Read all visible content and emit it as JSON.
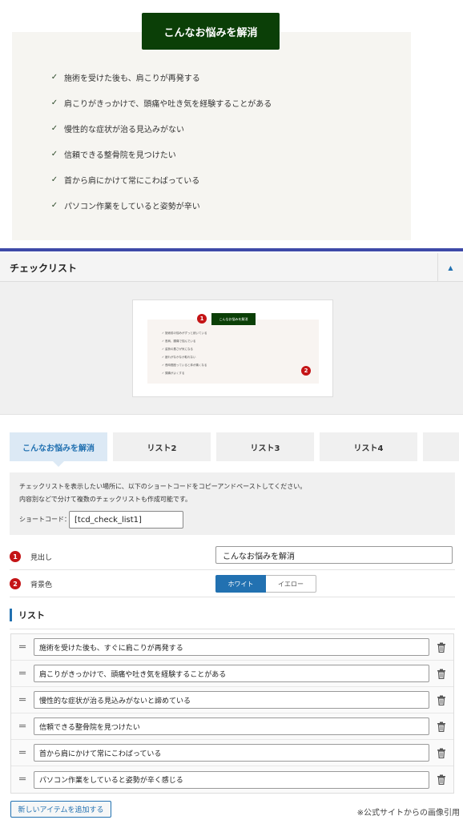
{
  "preview": {
    "title": "こんなお悩みを解消",
    "items": [
      "施術を受けた後も、肩こりが再発する",
      "肩こりがきっかけで、頭痛や吐き気を経験することがある",
      "慢性的な症状が治る見込みがない",
      "信頼できる整骨院を見つけたい",
      "首から肩にかけて常にこわばっている",
      "パソコン作業をしていると姿勢が辛い"
    ]
  },
  "panel": {
    "title": "チェックリスト",
    "toggle_icon": "▲"
  },
  "thumbnail": {
    "title": "こんなお悩みを解消",
    "badge1": "1",
    "badge2": "2",
    "lines": [
      "施術前の悩みがずっと続いている",
      "首肩、腰痛で悩んでいる",
      "姿勢の悪さが気になる",
      "疲れがなかなか取れない",
      "長時間座っていると体が痛くなる",
      "頭痛がよくする"
    ]
  },
  "tabs": [
    "こんなお悩みを解消",
    "リスト2",
    "リスト3",
    "リスト4",
    ""
  ],
  "info": {
    "line1": "チェックリストを表示したい場所に、以下のショートコードをコピーアンドペーストしてください。",
    "line2": "内容別などで分けて複数のチェックリストも作成可能です。",
    "shortcode_label": "ショートコード：",
    "shortcode_value": "[tcd_check_list1]"
  },
  "fields": {
    "heading": {
      "badge": "1",
      "label": "見出し",
      "value": "こんなお悩みを解消"
    },
    "bg": {
      "badge": "2",
      "label": "背景色",
      "on": "ホワイト",
      "off": "イエロー"
    }
  },
  "list": {
    "heading": "リスト",
    "items": [
      "施術を受けた後も、すぐに肩こりが再発する",
      "肩こりがきっかけで、頭痛や吐き気を経験することがある",
      "慢性的な症状が治る見込みがないと諦めている",
      "信頼できる整骨院を見つけたい",
      "首から肩にかけて常にこわばっている",
      "パソコン作業をしていると姿勢が辛く感じる"
    ],
    "add_button": "新しいアイテムを追加する"
  },
  "credit": "※公式サイトからの画像引用",
  "colors": {
    "title_bg": "#0b3f07",
    "accent": "#2271b1",
    "badge": "#c41416",
    "divider": "#3e4aa8"
  }
}
